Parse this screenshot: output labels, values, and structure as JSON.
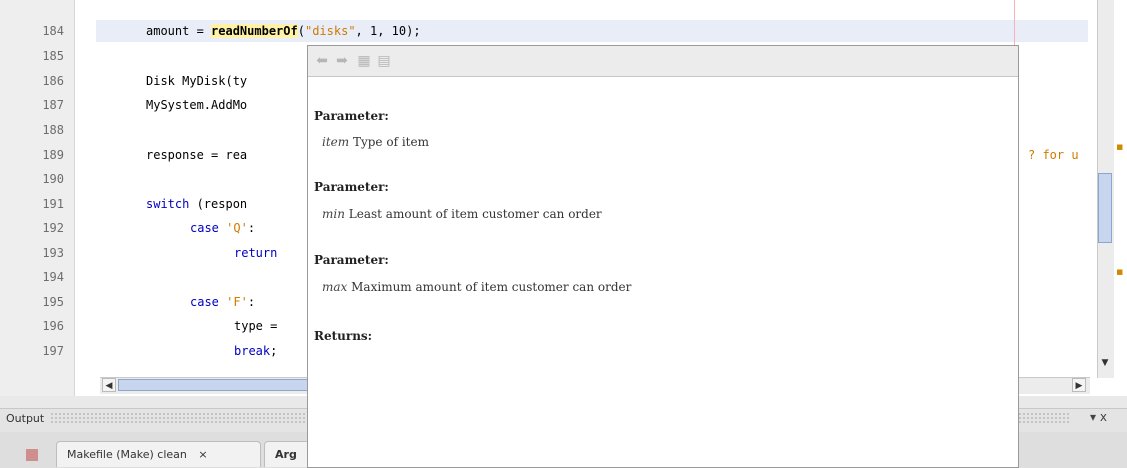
{
  "editor": {
    "line_numbers": [
      "184",
      "185",
      "186",
      "187",
      "188",
      "189",
      "190",
      "191",
      "192",
      "193",
      "194",
      "195",
      "196",
      "197"
    ],
    "lines": {
      "l184": {
        "pre": "amount = ",
        "fn": "readNumberOf",
        "paren": "(",
        "str": "\"disks\"",
        "post": ", 1, 10);"
      },
      "l186": "Disk MyDisk(ty",
      "l187": "MySystem.AddMo",
      "l189": "response = rea",
      "l191": {
        "kw": "switch",
        "post": " (respon"
      },
      "l192": {
        "kw": "case",
        "str": " 'Q'",
        "post": ":"
      },
      "l193": {
        "kw": "return"
      },
      "l195": {
        "kw": "case",
        "str": " 'F'",
        "post": ":"
      },
      "l196": "type =",
      "l197": {
        "kw": "break",
        "post": ";"
      },
      "right_fragment": "? for u"
    }
  },
  "popup": {
    "toolbar_icons": [
      "back-icon",
      "forward-icon",
      "open-in-browser-icon",
      "open-source-icon"
    ],
    "params": [
      {
        "label": "Parameter:",
        "name": "item",
        "desc": "Type of item"
      },
      {
        "label": "Parameter:",
        "name": "min",
        "desc": "Least amount of item customer can order"
      },
      {
        "label": "Parameter:",
        "name": "max",
        "desc": "Maximum amount of item customer can order"
      }
    ],
    "returns_label": "Returns:"
  },
  "output": {
    "title": "Output",
    "controls": "▾ x",
    "tabs": [
      {
        "label": "Makefile (Make) clean",
        "close": "×"
      },
      {
        "label": "Arg"
      }
    ]
  },
  "colors": {
    "keyword": "#0000c0",
    "string": "#ce7b00",
    "function_highlight": "#fff1a6",
    "current_line": "#e8edf8"
  }
}
